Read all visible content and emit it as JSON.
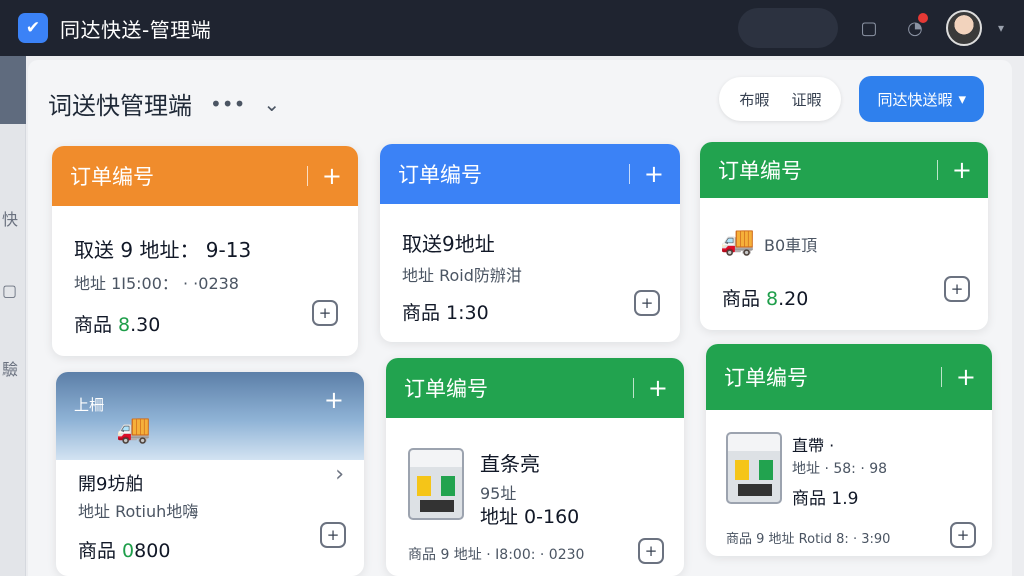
{
  "app": {
    "title": "同达快送-管理端"
  },
  "page": {
    "title": "词送快管理端",
    "more": "•••",
    "caret": "⌄"
  },
  "header_actions": {
    "pill_a": "布暇",
    "pill_b": "证暇",
    "primary": "同达快送暇",
    "primary_caret": "▾"
  },
  "icons": {
    "logo": "✔",
    "bell": "◔",
    "box": "▢",
    "plus": "+",
    "add_box": "+",
    "chevron": "›",
    "truck": "🚚",
    "dropdown": "▾"
  },
  "sidebar": {
    "labels": [
      "快",
      "▢",
      "驗"
    ]
  },
  "cards": [
    {
      "header": "订单编号",
      "line1": "取送 9 地址： 9-13",
      "line2": "地址 1I5:00： · ·0238",
      "line3_prefix": "商品 ",
      "line3_num": "8",
      "line3_suffix": ".30"
    },
    {
      "header": "订单编号",
      "line1": "取送9地址",
      "line2": "地址 Roid防辦泔",
      "line3": "商品 1:30"
    },
    {
      "header": "订单编号",
      "line1": "B0車頂",
      "line3_prefix": "商品 ",
      "line3_num": "8",
      "line3_suffix": ".20"
    },
    {
      "header": "上柵",
      "line1": "開9坊舶",
      "line2": "地址 Rotiuh地嗨",
      "line3_prefix": "商品 ",
      "line3_num": "0",
      "line3_suffix": "800"
    },
    {
      "header": "订单编号",
      "line1": "直条亮",
      "line2": "95址",
      "line2b": "地址 0-160",
      "line3": "商品 9 地址 · I8:00: · 0230"
    },
    {
      "header": "订单编号",
      "line1": "直帶 ·",
      "line2": "地址 · 58: · 98",
      "line3": "商品 1.9",
      "line4": "商品 9 地址 Rotid 8: · 3:90"
    }
  ],
  "colors": {
    "titlebar": "#1f2430",
    "orange": "#f08c2c",
    "blue": "#3b82f6",
    "green": "#22a34f",
    "accent_num": "#1e9e4a"
  }
}
